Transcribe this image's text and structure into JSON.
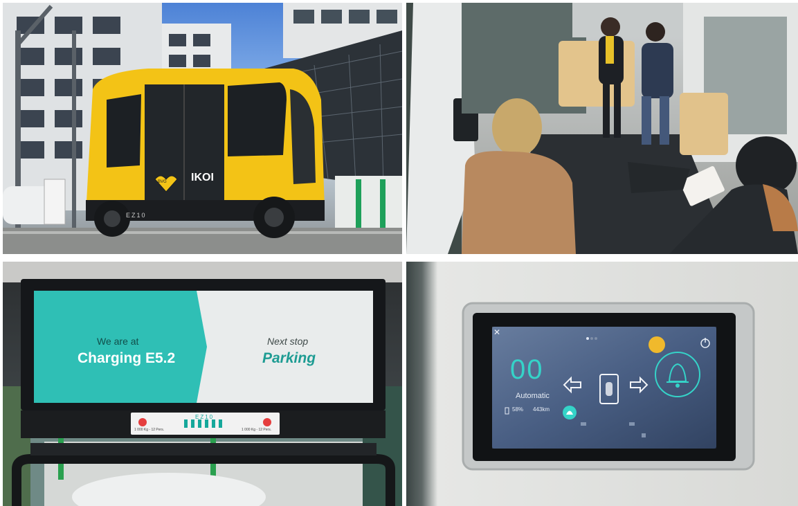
{
  "panels": [
    {
      "id": "bus-exterior",
      "vehicle_text": {
        "brand": "EZ10",
        "logo_text": "IKOI",
        "badge_text": "BVG"
      }
    },
    {
      "id": "bus-interior"
    },
    {
      "id": "passenger-display",
      "screen": {
        "left_caption": "We are at",
        "left_value": "Charging E5.2",
        "right_caption": "Next stop",
        "right_value": "Parking"
      },
      "sign": {
        "brand": "EZ10",
        "left_capacity": "1 000 Kg - 12 Pers.",
        "right_capacity": "1 000 Kg - 12 Pers."
      }
    },
    {
      "id": "control-tablet",
      "tablet": {
        "speed": "00",
        "mode": "Automatic",
        "battery": "58%",
        "range": "443km",
        "close_glyph": "✕"
      }
    }
  ],
  "colors": {
    "bus_yellow": "#f3c316",
    "screen_teal": "#2fbfb5",
    "tablet_teal": "#35d3c8",
    "sky": "#4d82d6"
  },
  "icons": [
    "bell-icon",
    "arrow-left-icon",
    "arrow-right-icon",
    "close-icon",
    "eco-icon",
    "power-icon"
  ]
}
